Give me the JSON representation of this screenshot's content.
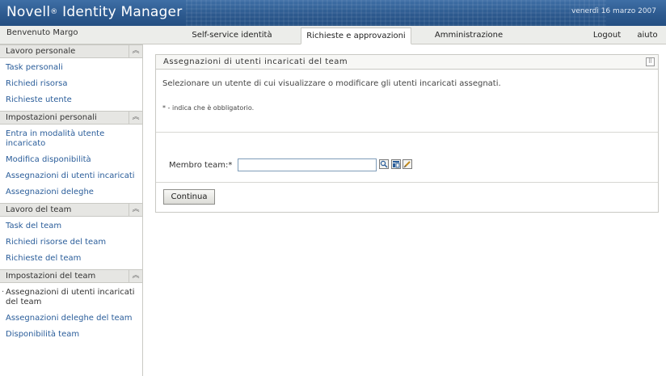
{
  "header": {
    "app_title": "Novell",
    "app_title_reg": "®",
    "app_title_rest": "Identity Manager",
    "date": "venerdì 16 marzo 2007"
  },
  "topbar": {
    "welcome": "Benvenuto Margo",
    "tabs": [
      {
        "label": "Self-service identità",
        "active": false
      },
      {
        "label": "Richieste e approvazioni",
        "active": true
      },
      {
        "label": "Amministrazione",
        "active": false
      }
    ],
    "logout": "Logout",
    "help": "aiuto"
  },
  "sidebar": {
    "sections": [
      {
        "title": "Lavoro personale",
        "items": [
          {
            "label": "Task personali"
          },
          {
            "label": "Richiedi risorsa"
          },
          {
            "label": "Richieste utente"
          }
        ]
      },
      {
        "title": "Impostazioni personali",
        "items": [
          {
            "label": "Entra in modalità utente incaricato"
          },
          {
            "label": "Modifica disponibilità"
          },
          {
            "label": "Assegnazioni di utenti incaricati"
          },
          {
            "label": "Assegnazioni deleghe"
          }
        ]
      },
      {
        "title": "Lavoro del team",
        "items": [
          {
            "label": "Task del team"
          },
          {
            "label": "Richiedi risorse del team"
          },
          {
            "label": "Richieste del team"
          }
        ]
      },
      {
        "title": "Impostazioni del team",
        "items": [
          {
            "label": "Assegnazioni di utenti incaricati del team"
          },
          {
            "label": "Assegnazioni deleghe del team"
          },
          {
            "label": "Disponibilità team"
          }
        ]
      }
    ]
  },
  "main": {
    "panel_title": "Assegnazioni di utenti incaricati del team",
    "instruction": "Selezionare un utente di cui visualizzare o modificare gli utenti incaricati assegnati.",
    "required_note": "* - indica che è obbligatorio.",
    "member_label": "Membro team:*",
    "member_value": "",
    "continue_label": "Continua"
  },
  "colors": {
    "banner": "#2d5a8f",
    "link": "#2a5d9a",
    "section_header_bg": "#e6e6e3"
  }
}
